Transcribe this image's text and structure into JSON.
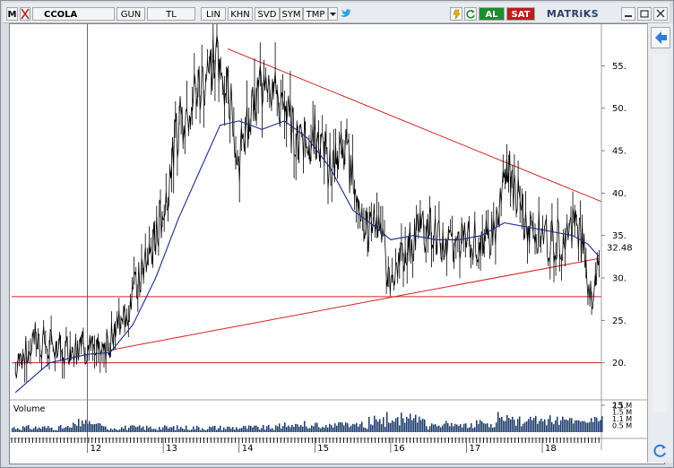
{
  "toolbar": {
    "app_letter": "M",
    "symbol": "CCOLA",
    "buttons": [
      "GUN",
      "TL",
      "LIN",
      "KHN",
      "SVD",
      "SYM",
      "TMP"
    ],
    "al_label": "AL",
    "sat_label": "SAT",
    "brand": "MATRiKS",
    "icons": [
      "flag-icon",
      "chevron-down-icon",
      "twitter-icon",
      "minimize-icon",
      "maximize-icon",
      "close-icon",
      "back-arrow-icon",
      "refresh-icon"
    ]
  },
  "volume_label": "Volume",
  "last_price_label": "32.48",
  "colors": {
    "price": "#000000",
    "moving_average": "#1c2a8c",
    "trendlines": "#d22020",
    "volume": "#1a3a6a",
    "al": "#1d8d2e",
    "sat": "#c21b1b"
  },
  "chart_data": {
    "type": "line",
    "x_ticks": [
      "12",
      "13",
      "14",
      "15",
      "16",
      "17",
      "18"
    ],
    "y_ticks": [
      15,
      20,
      25,
      30,
      35,
      40,
      45,
      50,
      55
    ],
    "ylim": [
      15,
      58
    ],
    "last_value": 32.48,
    "volume_ticks": [
      "2.1 M",
      "1.5 M",
      "1.1 M",
      "0.5 M"
    ],
    "series": [
      {
        "x": [
          11.05,
          11.3,
          11.6,
          11.9,
          12.2,
          12.5,
          12.8,
          13.0,
          13.2,
          13.45,
          13.7,
          13.85,
          14.0,
          14.2,
          14.35,
          14.6,
          14.8,
          15.0,
          15.2,
          15.4,
          15.55,
          15.7,
          15.85,
          16.0,
          16.2,
          16.5,
          16.8,
          17.0,
          17.2,
          17.4,
          17.55,
          17.75,
          17.9,
          18.1,
          18.3,
          18.45,
          18.55,
          18.65,
          18.75
        ],
        "values": [
          19,
          23,
          21.5,
          22,
          21,
          26,
          32,
          38,
          48,
          52,
          56,
          53,
          44,
          50,
          55,
          49,
          46,
          47,
          43,
          45,
          40,
          35,
          38,
          28,
          34,
          36,
          33,
          35,
          34,
          36,
          43,
          37,
          36,
          34,
          35,
          37,
          33,
          27,
          32.5
        ]
      },
      {
        "x": [
          11.05,
          11.5,
          12.0,
          12.3,
          12.6,
          12.9,
          13.2,
          13.5,
          13.75,
          14.0,
          14.3,
          14.6,
          14.9,
          15.2,
          15.5,
          15.8,
          16.0,
          16.3,
          16.6,
          16.9,
          17.2,
          17.5,
          17.8,
          18.1,
          18.4,
          18.6,
          18.75
        ],
        "values": [
          16.5,
          20,
          21,
          21.2,
          24.5,
          30,
          37,
          43,
          48,
          48.5,
          47.5,
          48.5,
          46.5,
          43,
          38,
          36,
          34.5,
          35,
          34.5,
          34.5,
          35,
          36.5,
          36,
          35.5,
          35,
          34,
          32.5
        ]
      }
    ],
    "trendlines": [
      {
        "from": [
          13.85,
          57
        ],
        "to": [
          18.78,
          39
        ]
      },
      {
        "from": [
          12.3,
          21.5
        ],
        "to": [
          16.05,
          27.8
        ]
      },
      {
        "from": [
          16.05,
          27.8
        ],
        "to": [
          18.75,
          32.3
        ]
      },
      {
        "from": [
          11.0,
          27.8
        ],
        "to": [
          18.78,
          27.8
        ]
      },
      {
        "from": [
          11.0,
          20.0
        ],
        "to": [
          18.78,
          20.0
        ]
      }
    ]
  }
}
